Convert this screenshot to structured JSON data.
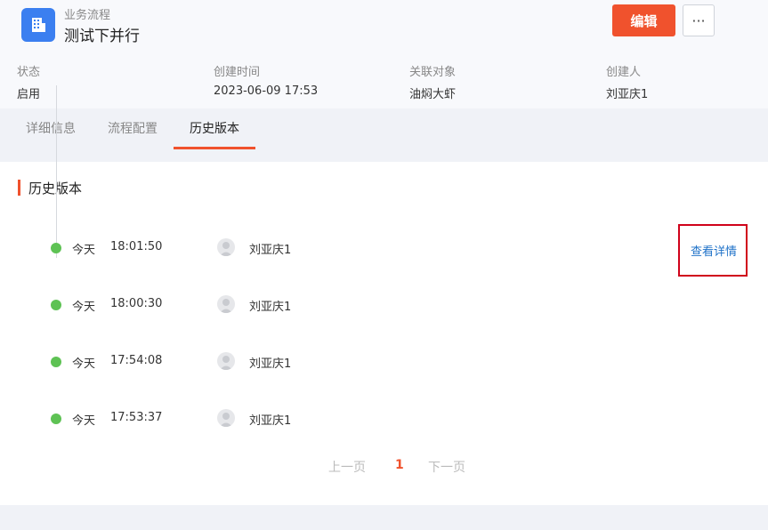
{
  "header": {
    "breadcrumb": "业务流程",
    "title": "测试下并行",
    "edit_label": "编辑",
    "more_label": "···"
  },
  "meta": [
    {
      "label": "状态",
      "value": "启用"
    },
    {
      "label": "创建时间",
      "value": "2023-06-09 17:53"
    },
    {
      "label": "关联对象",
      "value": "油焖大虾"
    },
    {
      "label": "创建人",
      "value": "刘亚庆1"
    }
  ],
  "tabs": [
    {
      "label": "详细信息",
      "active": false
    },
    {
      "label": "流程配置",
      "active": false
    },
    {
      "label": "历史版本",
      "active": true
    }
  ],
  "section": {
    "title": "历史版本"
  },
  "history": [
    {
      "day": "今天",
      "time": "18:01:50",
      "user": "刘亚庆1"
    },
    {
      "day": "今天",
      "time": "18:00:30",
      "user": "刘亚庆1"
    },
    {
      "day": "今天",
      "time": "17:54:08",
      "user": "刘亚庆1"
    },
    {
      "day": "今天",
      "time": "17:53:37",
      "user": "刘亚庆1"
    }
  ],
  "detail_link": "查看详情",
  "pagination": {
    "prev": "上一页",
    "current": "1",
    "next": "下一页"
  },
  "colors": {
    "accent": "#f0522d",
    "primary": "#3b7ff0",
    "link": "#1f72c8",
    "success": "#5ec254",
    "highlight": "#d0021b"
  }
}
